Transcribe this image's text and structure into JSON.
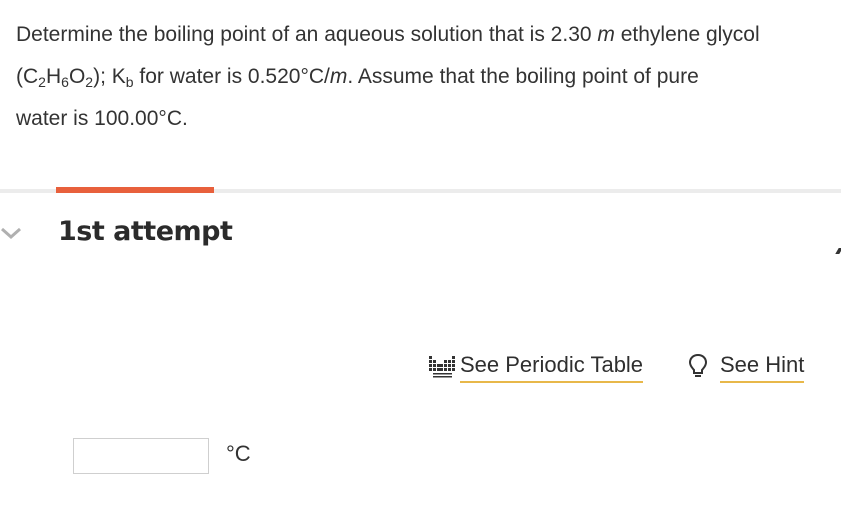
{
  "question": {
    "line1_prefix": "Determine the boiling point of an aqueous solution that is 2.30 ",
    "molality_symbol": "m",
    "line1_suffix": " ethylene glycol",
    "formula_open": "(C",
    "formula_sub1": "2",
    "formula_h": "H",
    "formula_sub2": "6",
    "formula_o": "O",
    "formula_sub3": "2",
    "formula_close": "); K",
    "kb_sub": "b",
    "kb_text": " for water is 0.520°C/",
    "kb_unit": "m",
    "line2_suffix": ". Assume that the boiling point of pure",
    "line3": "water is 100.00°C."
  },
  "attempt": {
    "title": "1st attempt"
  },
  "tools": {
    "periodic_table_label": "See Periodic Table",
    "hint_label": "See Hint"
  },
  "answer": {
    "value": "",
    "placeholder": "",
    "unit": "°C"
  },
  "colors": {
    "accent": "#e8603c",
    "link_underline": "#e8b84a",
    "divider": "#ececec"
  }
}
